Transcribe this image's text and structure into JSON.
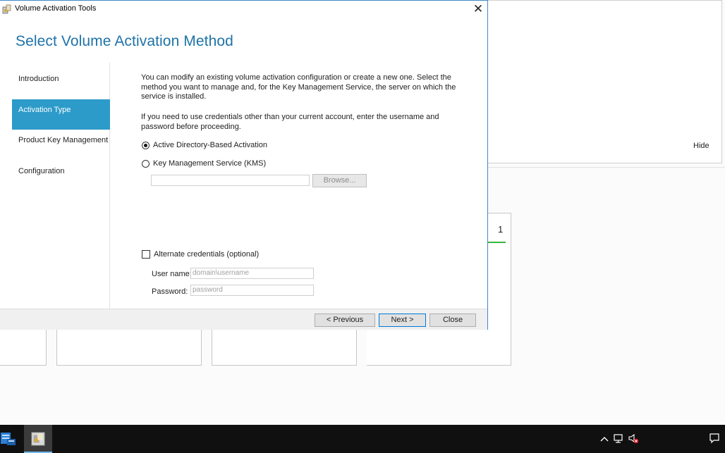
{
  "window": {
    "title": "Volume Activation Tools",
    "close_glyph": "✕",
    "heading": "Select Volume Activation Method"
  },
  "nav": {
    "items": [
      {
        "label": "Introduction",
        "active": false
      },
      {
        "label": "Activation Type",
        "active": true
      },
      {
        "label": "Product Key Management",
        "active": false
      },
      {
        "label": "Configuration",
        "active": false
      }
    ]
  },
  "content": {
    "para1": "You can modify an existing volume activation configuration or create a new one. Select the method you want to manage and, for the Key Management Service, the server on which the service is installed.",
    "para2": "If you need to use credentials other than your current account, enter the username and password before proceeding.",
    "radio_adba": {
      "label": "Active Directory-Based Activation",
      "selected": true
    },
    "radio_kms": {
      "label": "Key Management Service (KMS)",
      "selected": false
    },
    "kms_server_value": "",
    "browse_label": "Browse...",
    "alt_creds": {
      "label": "Alternate credentials (optional)",
      "checked": false
    },
    "username_label": "User name:",
    "username_placeholder": "domain\\username",
    "password_label": "Password:",
    "password_placeholder": "password"
  },
  "footer": {
    "previous_label": "< Previous",
    "next_label": "Next >",
    "close_label": "Close"
  },
  "background": {
    "hide_label": "Hide",
    "count": "1"
  },
  "colors": {
    "accent": "#2d9bc9",
    "heading": "#1e73a8",
    "status_green": "#36b83c"
  },
  "icons": {
    "app": "volume-activation-icon",
    "taskbar_server": "server-manager-icon",
    "taskbar_app": "volume-activation-taskbar-icon",
    "tray": [
      "chevron-up-icon",
      "network-icon",
      "volume-muted-icon",
      "notifications-icon"
    ]
  }
}
